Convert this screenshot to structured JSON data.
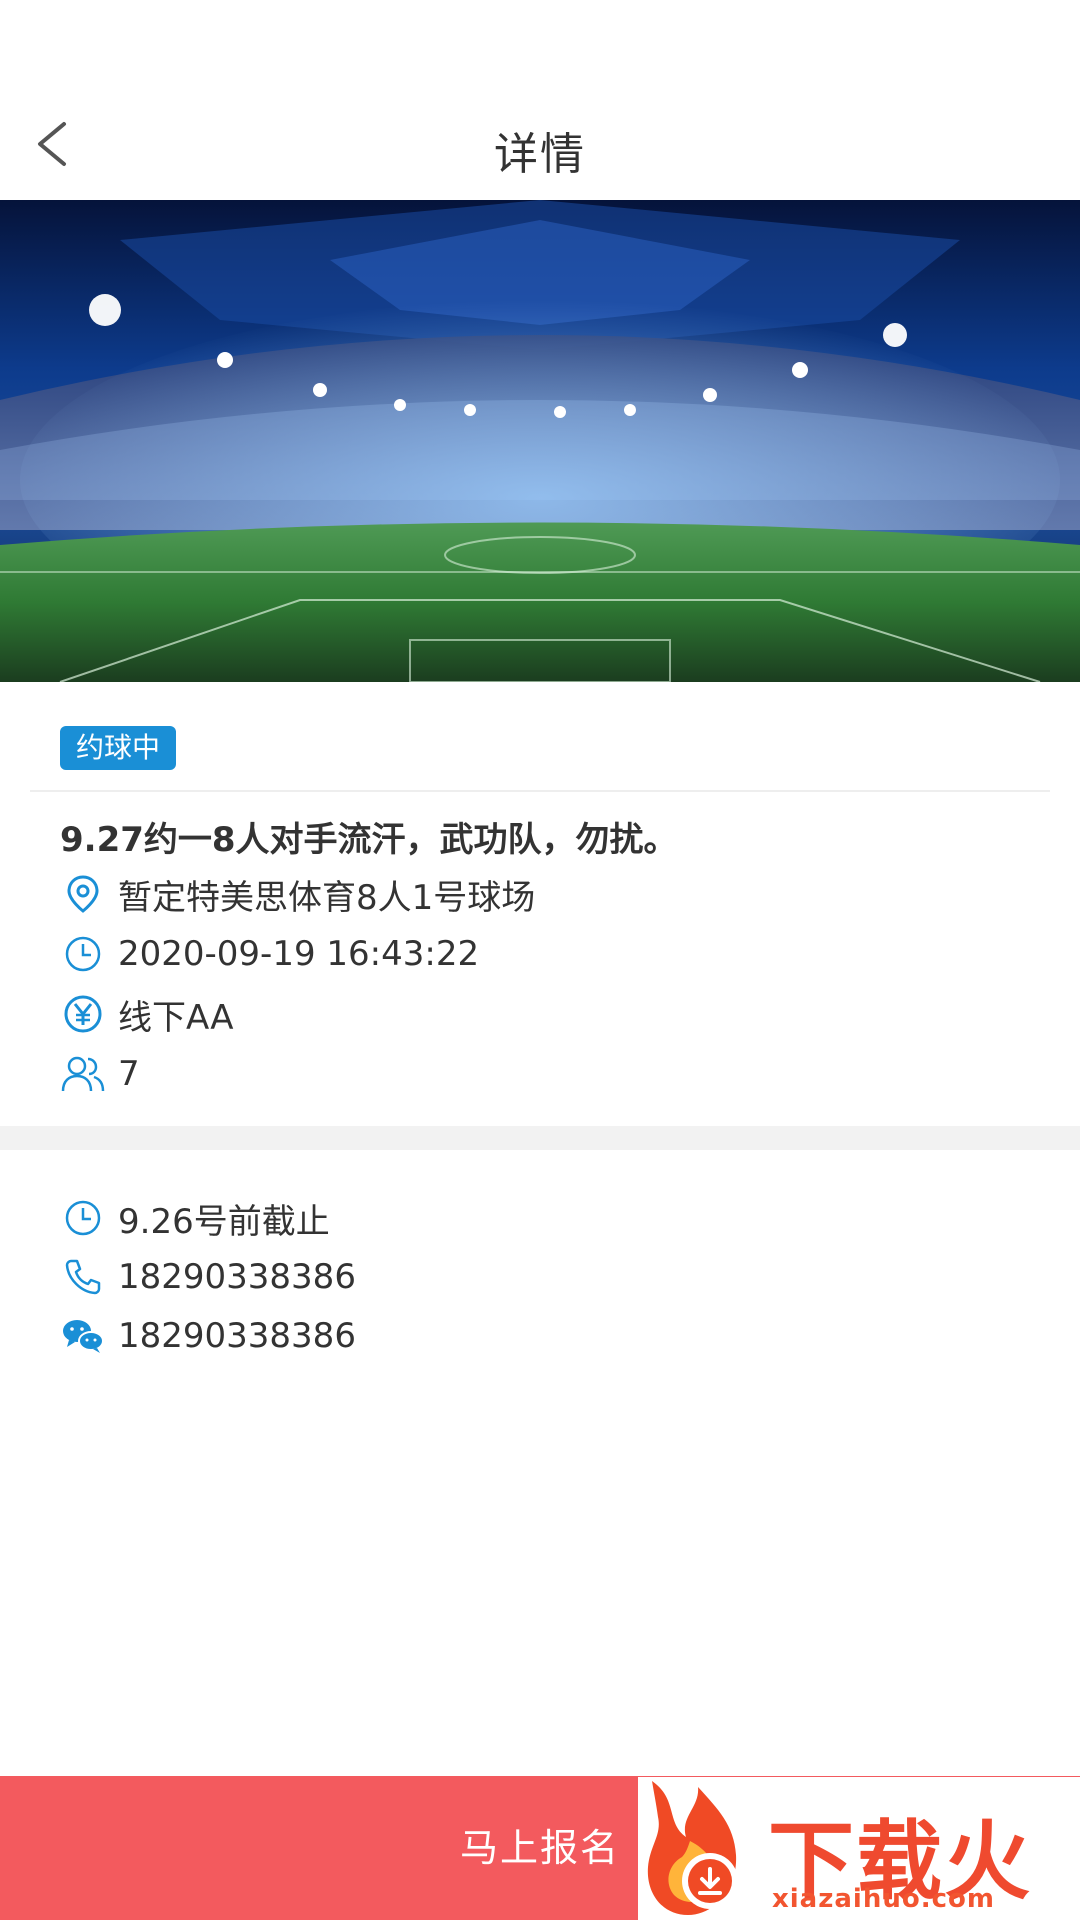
{
  "header": {
    "title": "详情",
    "back_icon": "chevron-left-icon"
  },
  "hero": {
    "image_desc_icon": "stadium-banner-image"
  },
  "info": {
    "status_badge": "约球中",
    "title": "9.27约一8人对手流汗，武功队，勿扰。",
    "location": "暂定特美思体育8人1号球场",
    "datetime": "2020-09-19 16:43:22",
    "fee": "线下AA",
    "people": "7"
  },
  "contact": {
    "deadline": "9.26号前截止",
    "phone": "18290338386",
    "wechat": "18290338386"
  },
  "footer": {
    "signup_label": "马上报名"
  },
  "watermark": {
    "brand": "下载火",
    "url": "xiazaihuo.com"
  },
  "colors": {
    "accent": "#1a8fd6",
    "footer": "#f35a5e",
    "watermark": "#ef4a2f"
  }
}
